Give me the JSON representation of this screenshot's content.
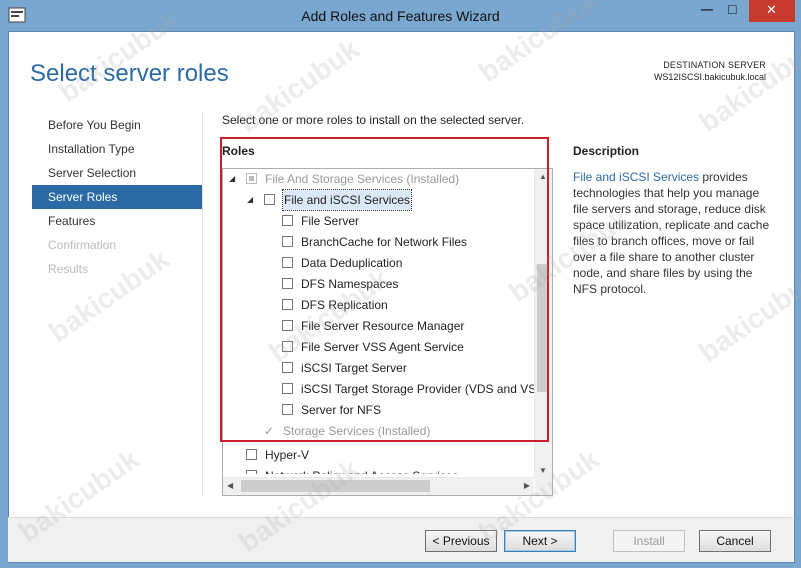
{
  "window": {
    "title": "Add Roles and Features Wizard",
    "minimize_glyph": "—",
    "maximize_glyph": "□",
    "close_glyph": "✕"
  },
  "page": {
    "title": "Select server roles",
    "destination_label": "DESTINATION SERVER",
    "destination_server": "WS12ISCSI.bakicubuk.local"
  },
  "nav": {
    "items": [
      {
        "label": "Before You Begin",
        "state": "normal"
      },
      {
        "label": "Installation Type",
        "state": "normal"
      },
      {
        "label": "Server Selection",
        "state": "normal"
      },
      {
        "label": "Server Roles",
        "state": "active"
      },
      {
        "label": "Features",
        "state": "normal"
      },
      {
        "label": "Confirmation",
        "state": "disabled"
      },
      {
        "label": "Results",
        "state": "disabled"
      }
    ]
  },
  "main": {
    "instruction": "Select one or more roles to install on the selected server.",
    "roles_heading": "Roles",
    "roles": [
      {
        "label": "File And Storage Services (Installed)",
        "indent": 0,
        "state": "indeterminate-disabled",
        "expander": "◢"
      },
      {
        "label": "File and iSCSI Services",
        "indent": 1,
        "state": "unchecked",
        "expander": "◢",
        "selected": true
      },
      {
        "label": "File Server",
        "indent": 2,
        "state": "unchecked"
      },
      {
        "label": "BranchCache for Network Files",
        "indent": 2,
        "state": "unchecked"
      },
      {
        "label": "Data Deduplication",
        "indent": 2,
        "state": "unchecked"
      },
      {
        "label": "DFS Namespaces",
        "indent": 2,
        "state": "unchecked"
      },
      {
        "label": "DFS Replication",
        "indent": 2,
        "state": "unchecked"
      },
      {
        "label": "File Server Resource Manager",
        "indent": 2,
        "state": "unchecked"
      },
      {
        "label": "File Server VSS Agent Service",
        "indent": 2,
        "state": "unchecked"
      },
      {
        "label": "iSCSI Target Server",
        "indent": 2,
        "state": "unchecked"
      },
      {
        "label": "iSCSI Target Storage Provider (VDS and VSS",
        "indent": 2,
        "state": "unchecked"
      },
      {
        "label": "Server for NFS",
        "indent": 2,
        "state": "unchecked"
      },
      {
        "label": "Storage Services (Installed)",
        "indent": 1,
        "state": "checked-disabled"
      },
      {
        "label": "Hyper-V",
        "indent": 0,
        "state": "unchecked"
      },
      {
        "label": "Network Policy and Access Services",
        "indent": 0,
        "state": "unchecked",
        "clipped": true
      }
    ]
  },
  "description": {
    "heading": "Description",
    "link": "File and iSCSI Services",
    "text": " provides technologies that help you manage file servers and storage, reduce disk space utilization, replicate and cache files to branch offices, move or fail over a file share to another cluster node, and share files by using the NFS protocol."
  },
  "buttons": {
    "previous": "< Previous",
    "next": "Next >",
    "install": "Install",
    "cancel": "Cancel"
  },
  "watermark": "bakicubuk",
  "colors": {
    "accent": "#2b6aa5",
    "highlight_box": "#c8202a",
    "close_button": "#c73a2e"
  }
}
